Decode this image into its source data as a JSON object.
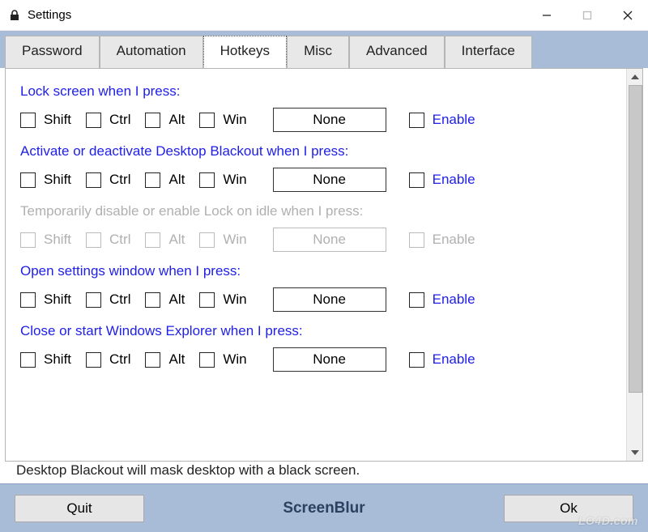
{
  "window": {
    "title": "Settings"
  },
  "tabs": [
    {
      "label": "Password"
    },
    {
      "label": "Automation"
    },
    {
      "label": "Hotkeys"
    },
    {
      "label": "Misc"
    },
    {
      "label": "Advanced"
    },
    {
      "label": "Interface"
    }
  ],
  "active_tab_index": 2,
  "modifiers": {
    "shift": "Shift",
    "ctrl": "Ctrl",
    "alt": "Alt",
    "win": "Win"
  },
  "key_none": "None",
  "enable_label": "Enable",
  "sections": [
    {
      "title": "Lock screen when I press:",
      "disabled": false
    },
    {
      "title": "Activate or deactivate Desktop Blackout when I press:",
      "disabled": false
    },
    {
      "title": "Temporarily disable or enable Lock on idle when I press:",
      "disabled": true
    },
    {
      "title": "Open settings window when I press:",
      "disabled": false
    },
    {
      "title": "Close or start Windows Explorer when I press:",
      "disabled": false
    }
  ],
  "hint": "Desktop Blackout will mask desktop with a black screen.",
  "footer": {
    "quit": "Quit",
    "ok": "Ok",
    "appname": "ScreenBlur"
  },
  "watermark": "LO4D.com"
}
